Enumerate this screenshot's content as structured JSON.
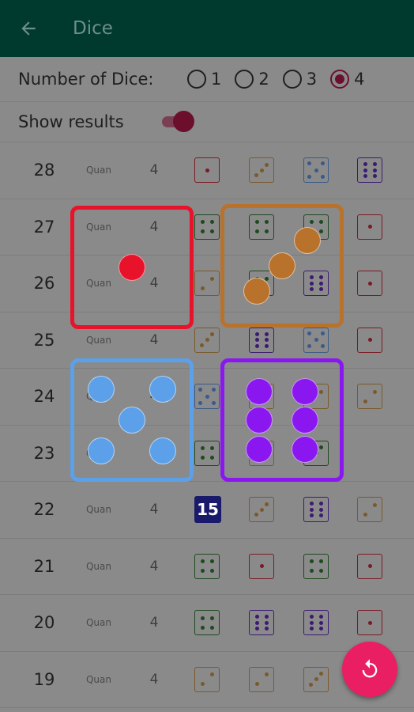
{
  "appbar": {
    "title": "Dice",
    "back_icon": "arrow-back-icon"
  },
  "controls": {
    "count_label": "Number of Dice:",
    "options": [
      "1",
      "2",
      "3",
      "4"
    ],
    "selected": "4",
    "show_results_label": "Show results",
    "show_results": true
  },
  "history": [
    {
      "num": "28",
      "quan": "Quan",
      "dice": "4",
      "faces": [
        1,
        3,
        5,
        6
      ],
      "colors": [
        "red",
        "orange",
        "blue",
        "purple"
      ]
    },
    {
      "num": "27",
      "quan": "Quan",
      "dice": "4",
      "faces": [
        4,
        4,
        4,
        1
      ],
      "colors": [
        "green",
        "green",
        "green",
        "red"
      ]
    },
    {
      "num": "26",
      "quan": "Quan",
      "dice": "4",
      "faces": [
        2,
        4,
        6,
        1
      ],
      "colors": [
        "orange",
        "green",
        "purple",
        "red"
      ]
    },
    {
      "num": "25",
      "quan": "Quan",
      "dice": "4",
      "faces": [
        3,
        6,
        5,
        1
      ],
      "colors": [
        "orange",
        "purple",
        "blue",
        "red"
      ]
    },
    {
      "num": "24",
      "quan": "Quan",
      "dice": "4",
      "faces": [
        5,
        2,
        2,
        2
      ],
      "colors": [
        "blue",
        "orange",
        "orange",
        "orange"
      ]
    },
    {
      "num": "23",
      "quan": "Quan",
      "dice": "4",
      "faces": [
        4,
        3,
        3,
        0
      ],
      "colors": [
        "green",
        "orange",
        "green",
        "none"
      ]
    },
    {
      "num": "22",
      "quan": "Quan",
      "dice": "4",
      "faces": [
        0,
        3,
        6,
        2
      ],
      "colors": [
        "none",
        "orange",
        "purple",
        "orange"
      ]
    },
    {
      "num": "21",
      "quan": "Quan",
      "dice": "4",
      "faces": [
        4,
        1,
        4,
        1
      ],
      "colors": [
        "green",
        "red",
        "green",
        "red"
      ]
    },
    {
      "num": "20",
      "quan": "Quan",
      "dice": "4",
      "faces": [
        4,
        6,
        6,
        1
      ],
      "colors": [
        "green",
        "purple",
        "purple",
        "red"
      ]
    },
    {
      "num": "19",
      "quan": "Quan",
      "dice": "4",
      "faces": [
        2,
        2,
        3,
        0
      ],
      "colors": [
        "orange",
        "orange",
        "orange",
        "none"
      ]
    }
  ],
  "total_badge": "15",
  "current_roll": [
    {
      "face": 1,
      "color": "#e8132b"
    },
    {
      "face": 3,
      "color": "#b8722c"
    },
    {
      "face": 5,
      "color": "#5ba0e8"
    },
    {
      "face": 6,
      "color": "#8b17f0"
    }
  ],
  "palette": {
    "red": "#7a1a22",
    "orange": "#7a5a2a",
    "blue": "#3a5a88",
    "purple": "#3c1a72",
    "green": "#1e4a1e"
  },
  "fab": {
    "icon": "reroll-icon"
  }
}
